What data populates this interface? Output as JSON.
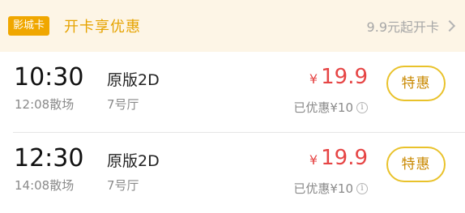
{
  "banner": {
    "badge": "影城卡",
    "promo": "开卡享优惠",
    "right_text": "9.9元起开卡",
    "chevron_icon": "chevron-right-icon"
  },
  "showtimes": [
    {
      "start": "10:30",
      "end": "12:08散场",
      "version": "原版2D",
      "hall": "7号厅",
      "price_symbol": "¥",
      "price": "19.9",
      "discount": "已优惠¥10",
      "info_icon": "i",
      "button": "特惠"
    },
    {
      "start": "12:30",
      "end": "14:08散场",
      "version": "原版2D",
      "hall": "7号厅",
      "price_symbol": "¥",
      "price": "19.9",
      "discount": "已优惠¥10",
      "info_icon": "i",
      "button": "特惠"
    }
  ],
  "colors": {
    "banner_bg": "#fdf5e6",
    "badge_bg": "#f0a700",
    "promo_text": "#e6a300",
    "price": "#e64545",
    "button_border": "#e9c22b",
    "button_text": "#c98800"
  }
}
